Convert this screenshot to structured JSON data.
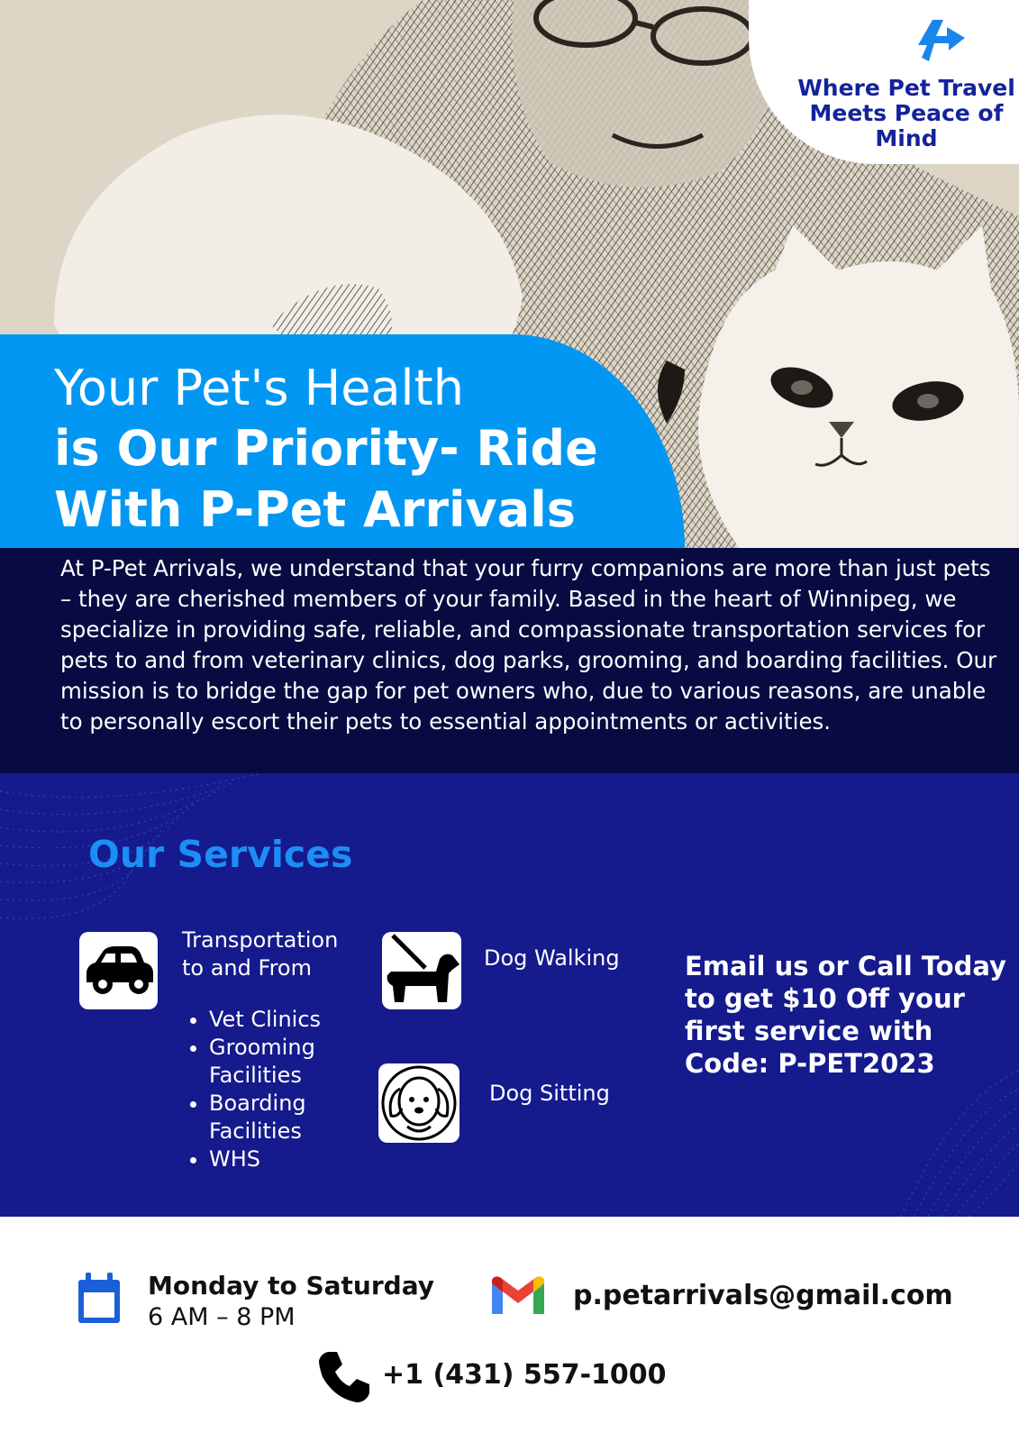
{
  "badge": {
    "tagline": "Where Pet Travel Meets Peace of Mind"
  },
  "hero": {
    "headline_line1": "Your Pet's Health",
    "headline_line2": "is Our Priority- Ride",
    "headline_line3": "With P-Pet Arrivals"
  },
  "intro": {
    "text": "At P-Pet Arrivals, we understand that your furry companions are more than just pets – they are cherished members of your family. Based in the heart of Winnipeg, we specialize in providing safe, reliable, and compassionate transportation services for pets to and from veterinary clinics, dog parks, grooming, and boarding facilities. Our mission is to bridge the gap for pet owners who, due to various reasons, are unable to personally escort their pets to essential appointments or activities."
  },
  "services": {
    "title": "Our Services",
    "transportation_line1": "Transportation",
    "transportation_line2": "to and From",
    "destinations": [
      "Vet Clinics",
      "Grooming Facilities",
      "Boarding Facilities",
      "WHS"
    ],
    "dog_walking": "Dog Walking",
    "dog_sitting": "Dog Sitting",
    "promo": "Email us or Call Today to get $10 Off your first service with Code: P-PET2023",
    "icons": [
      "car-icon",
      "dog-walking-icon",
      "dog-face-icon"
    ]
  },
  "contact": {
    "hours_title": "Monday to Saturday",
    "hours_time": "6 AM – 8 PM",
    "email": "p.petarrivals@gmail.com",
    "phone": "+1 (431) 557-1000",
    "icons": [
      "calendar-icon",
      "gmail-icon",
      "phone-icon"
    ]
  },
  "colors": {
    "hero_blue": "#0297f2",
    "intro_navy": "#070b42",
    "services_blue": "#151a8c",
    "title_blue": "#1c8ef6",
    "badge_text": "#14239a"
  }
}
